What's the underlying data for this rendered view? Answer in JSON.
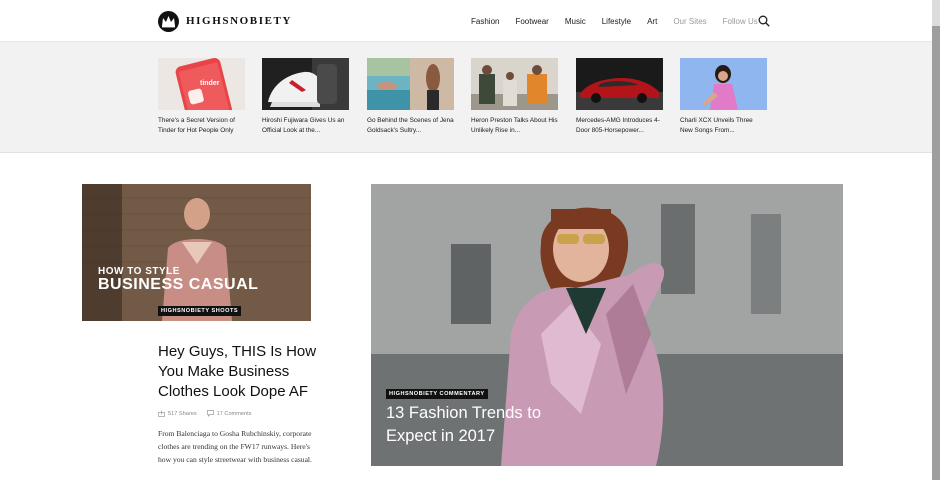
{
  "header": {
    "logo_text": "HIGHSNOBIETY",
    "nav": [
      {
        "label": "Fashion"
      },
      {
        "label": "Footwear"
      },
      {
        "label": "Music"
      },
      {
        "label": "Lifestyle"
      },
      {
        "label": "Art"
      },
      {
        "label": "Our Sites"
      },
      {
        "label": "Follow Us"
      }
    ]
  },
  "trending": [
    {
      "title": "There's a Secret Version of Tinder for Hot People Only",
      "thumb_text": "tinder"
    },
    {
      "title": "Hiroshi Fujiwara Gives Us an Official Look at the..."
    },
    {
      "title": "Go Behind the Scenes of Jena Goldsack's Sultry..."
    },
    {
      "title": "Heron Preston Talks About His Unlikely Rise in..."
    },
    {
      "title": "Mercedes-AMG Introduces 4-Door 805-Horsepower..."
    },
    {
      "title": "Charli XCX Unveils Three New Songs From..."
    }
  ],
  "featured_left": {
    "overlay_line1": "HOW TO STYLE",
    "overlay_line2": "BUSINESS CASUAL",
    "category": "HIGHSNOBIETY SHOOTS",
    "headline": "Hey Guys, THIS Is How You Make Business Clothes Look Dope AF",
    "shares": "517 Shares",
    "comments": "17 Comments",
    "excerpt": "From Balenciaga to Gosha Rubchinskiy, corporate clothes are trending on the FW17 runways. Here's how you can style streetwear with business casual."
  },
  "featured_right": {
    "category": "HIGHSNOBIETY COMMENTARY",
    "headline": "13 Fashion Trends to Expect in 2017"
  },
  "colors": {
    "tinder_red": "#e8454a",
    "car_red": "#b3141a",
    "sky_blue": "#8fb6ef",
    "metallic_pink": "#c89ab4"
  }
}
